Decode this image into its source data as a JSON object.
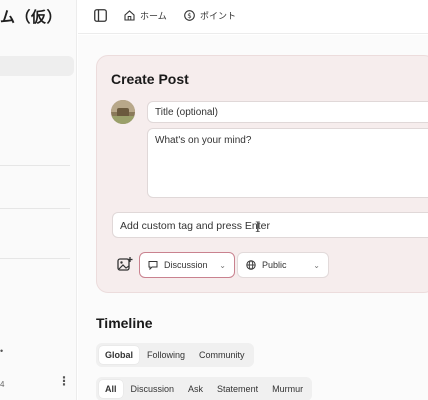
{
  "sidebar": {
    "app_title": "ム（仮）",
    "bottom_marker": "•",
    "bottom_text": "4",
    "more_label": "⋮"
  },
  "topbar": {
    "home_label": "ホーム",
    "points_label": "ポイント"
  },
  "create_post": {
    "heading": "Create Post",
    "title_placeholder": "Title (optional)",
    "body_placeholder": "What's on your mind?",
    "tag_placeholder": "Add custom tag and press Enter",
    "category_label": "Discussion",
    "visibility_label": "Public"
  },
  "timeline": {
    "heading": "Timeline",
    "scope_tabs": [
      {
        "label": "Global"
      },
      {
        "label": "Following"
      },
      {
        "label": "Community"
      }
    ],
    "filter_tabs": [
      {
        "label": "All"
      },
      {
        "label": "Discussion"
      },
      {
        "label": "Ask"
      },
      {
        "label": "Statement"
      },
      {
        "label": "Murmur"
      }
    ]
  },
  "colors": {
    "card_bg": "#f6eded",
    "accent_border": "#c9828f"
  }
}
